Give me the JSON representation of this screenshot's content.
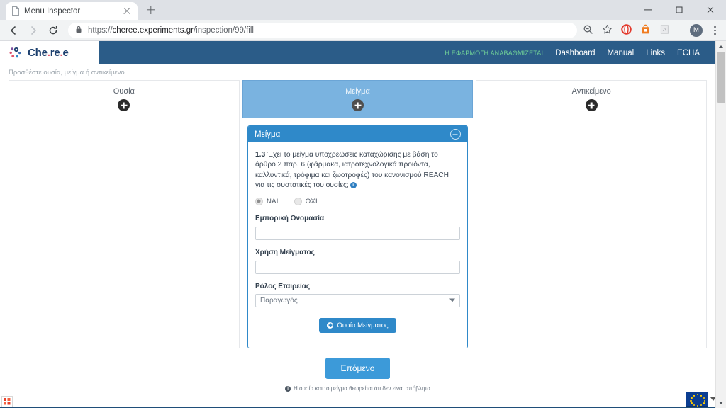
{
  "browser": {
    "tab": {
      "title": "Menu Inspector",
      "favicon_icon": "page-icon",
      "close_icon": "close-icon"
    },
    "new_tab_icon": "plus-icon",
    "window_controls": {
      "minimize": "minimize-icon",
      "maximize": "maximize-icon",
      "close": "close-icon"
    },
    "nav": {
      "back_icon": "arrow-left-icon",
      "forward_icon": "arrow-right-icon",
      "reload_icon": "reload-icon"
    },
    "omnibox": {
      "lock_icon": "lock-icon",
      "url_scheme": "https://",
      "url_host": "cheree.experiments.gr",
      "url_path": "/inspection/99/fill"
    },
    "toolbar_icons": [
      "zoom-out-icon",
      "star-icon",
      "opera-icon",
      "shopping-bag-icon",
      "pdf-icon",
      "profile-avatar-icon",
      "kebab-menu-icon"
    ],
    "avatar_letter": "M"
  },
  "app": {
    "logo": {
      "name_a": "Che",
      "dot1": ".",
      "name_b": "re",
      "dot2": ".",
      "name_c": "e",
      "icon": "molecule-icon"
    },
    "alert_text": "Η ΕΦΑΡΜΟΓΗ ΑΝΑΒΑΘΜΙΖΕΤΑΙ",
    "nav_links": [
      {
        "label": "Dashboard"
      },
      {
        "label": "Manual"
      },
      {
        "label": "Links"
      },
      {
        "label": "ECHA"
      }
    ],
    "colors": {
      "header_blue": "#2b5c88",
      "panel_blue": "#2f89c9",
      "active_card_blue": "#7ab3e0",
      "next_button_blue": "#3c9ad9",
      "alert_green": "#6fcf97"
    }
  },
  "breadcrumb": {
    "text": "Προσθέστε ουσία, μείγμα ή αντικείμενο"
  },
  "cards": [
    {
      "label": "Ουσία",
      "active": false,
      "add_icon": "plus-circle-icon"
    },
    {
      "label": "Μείγμα",
      "active": true,
      "add_icon": "plus-circle-icon"
    },
    {
      "label": "Αντικείμενο",
      "active": false,
      "add_icon": "plus-circle-icon"
    }
  ],
  "panel": {
    "title": "Μείγμα",
    "collapse_icon": "minus-circle-icon",
    "question": {
      "number": "1.3",
      "text": "Έχει το μείγμα υποχρεώσεις καταχώρισης με βάση το άρθρο 2 παρ. 6 (φάρμακα, ιατροτεχνολογικά προϊόντα, καλλυντικά, τρόφιμα και ζωοτροφές) του κανονισμού REACH για τις συστατικές του ουσίες;",
      "info_icon": "info-icon",
      "info_glyph": "i"
    },
    "radios": [
      {
        "label": "ΝΑΙ",
        "checked": true
      },
      {
        "label": "ΟΧΙ",
        "checked": false
      }
    ],
    "fields": [
      {
        "label": "Εμπορική Ονομασία",
        "value": "",
        "placeholder": ""
      },
      {
        "label": "Χρήση Μείγματος",
        "value": "",
        "placeholder": ""
      }
    ],
    "select": {
      "label": "Ρόλος Εταιρείας",
      "value": "Παραγωγός",
      "caret_icon": "chevron-down-icon"
    },
    "add_button": {
      "label": "Ουσία Μείγματος",
      "icon": "plus-circle-icon"
    }
  },
  "footer": {
    "next_button": "Επόμενο",
    "note": "Η ουσία και το μείγμα θεωρείται ότι δεν είναι απόβλητα",
    "note_icon": "info-icon",
    "note_glyph": "i"
  },
  "os": {
    "tray_left_icon": "app-tray-icon",
    "tray_flag_icon": "eu-flag-icon",
    "tray_caret_icon": "chevron-up-icon"
  }
}
